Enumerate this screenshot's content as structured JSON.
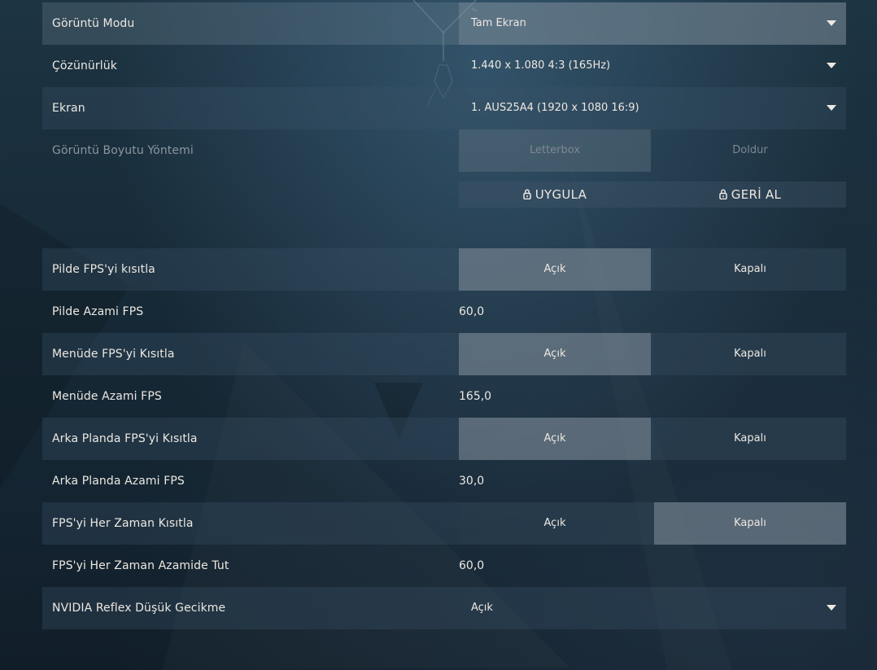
{
  "display": {
    "mode": {
      "label": "Görüntü Modu",
      "value": "Tam Ekran"
    },
    "resolution": {
      "label": "Çözünürlük",
      "value": "1.440 x 1.080 4:3 (165Hz)"
    },
    "monitor": {
      "label": "Ekran",
      "value": "1. AUS25A4 (1920 x  1080 16:9)"
    },
    "aspect_method": {
      "label": "Görüntü Boyutu Yöntemi",
      "options": [
        "Letterbox",
        "Doldur"
      ]
    },
    "apply_label": "UYGULA",
    "revert_label": "GERİ AL"
  },
  "fps": {
    "limit_battery": {
      "label": "Pilde FPS'yi kısıtla",
      "on": "Açık",
      "off": "Kapalı",
      "selected": "Açık"
    },
    "max_battery": {
      "label": "Pilde Azami FPS",
      "value": "60,0"
    },
    "limit_menu": {
      "label": "Menüde FPS'yi Kısıtla",
      "on": "Açık",
      "off": "Kapalı",
      "selected": "Açık"
    },
    "max_menu": {
      "label": "Menüde Azami FPS",
      "value": "165,0"
    },
    "limit_background": {
      "label": "Arka Planda FPS'yi Kısıtla",
      "on": "Açık",
      "off": "Kapalı",
      "selected": "Açık"
    },
    "max_background": {
      "label": "Arka Planda Azami FPS",
      "value": "30,0"
    },
    "limit_always": {
      "label": "FPS'yi Her Zaman Kısıtla",
      "on": "Açık",
      "off": "Kapalı",
      "selected": "Kapalı"
    },
    "max_always": {
      "label": "FPS'yi Her Zaman Azamide Tut",
      "value": "60,0"
    }
  },
  "reflex": {
    "label": "NVIDIA Reflex Düşük Gecikme",
    "value": "Açık"
  },
  "colors": {
    "selected_segment": "#8c969f",
    "text": "#ece8e1",
    "dim_text": "#8c969f"
  }
}
